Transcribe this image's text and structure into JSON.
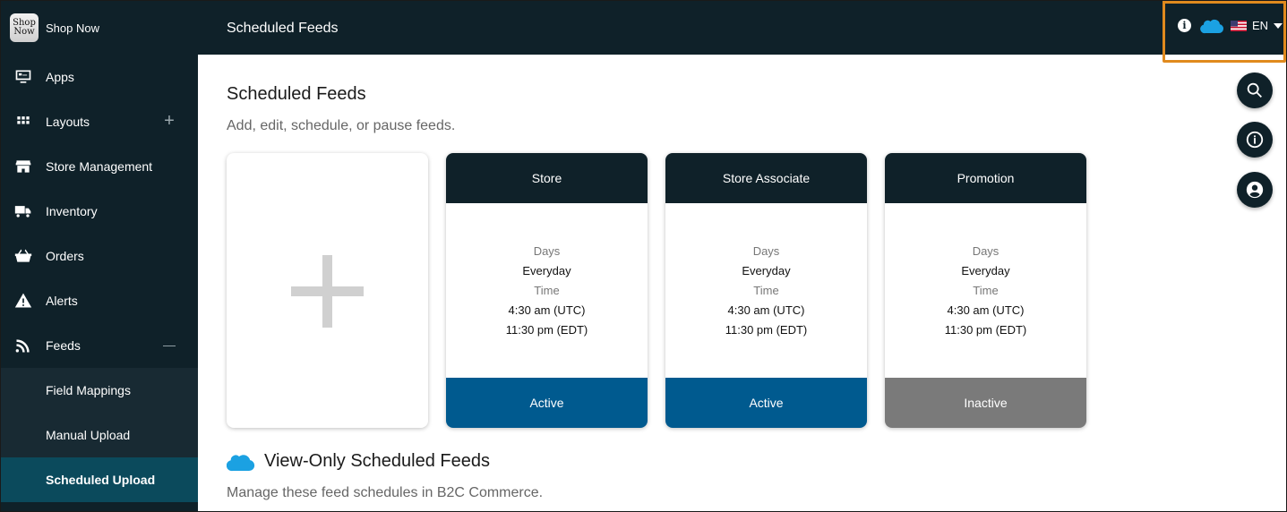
{
  "app": {
    "logo_line1": "Shop",
    "logo_line2": "Now",
    "name": "Shop Now"
  },
  "topbar": {
    "title": "Scheduled Feeds",
    "info_glyph": "i",
    "language": "EN"
  },
  "sidebar": {
    "items": [
      {
        "label": "Apps",
        "icon": "apps-monitor-icon"
      },
      {
        "label": "Layouts",
        "icon": "grid-icon",
        "toggle": "+"
      },
      {
        "label": "Store Management",
        "icon": "store-icon"
      },
      {
        "label": "Inventory",
        "icon": "truck-icon"
      },
      {
        "label": "Orders",
        "icon": "basket-icon"
      },
      {
        "label": "Alerts",
        "icon": "warning-icon"
      },
      {
        "label": "Feeds",
        "icon": "rss-icon",
        "toggle": "—"
      }
    ],
    "subitems": [
      {
        "label": "Field Mappings"
      },
      {
        "label": "Manual Upload"
      },
      {
        "label": "Scheduled Upload",
        "active": true
      }
    ]
  },
  "main": {
    "title": "Scheduled Feeds",
    "subtitle": "Add, edit, schedule, or pause feeds.",
    "feeds": [
      {
        "name": "Store",
        "days_label": "Days",
        "days": "Everyday",
        "time_label": "Time",
        "time_utc": "4:30 am (UTC)",
        "time_local": "11:30 pm (EDT)",
        "status": "Active"
      },
      {
        "name": "Store Associate",
        "days_label": "Days",
        "days": "Everyday",
        "time_label": "Time",
        "time_utc": "4:30 am (UTC)",
        "time_local": "11:30 pm (EDT)",
        "status": "Active"
      },
      {
        "name": "Promotion",
        "days_label": "Days",
        "days": "Everyday",
        "time_label": "Time",
        "time_utc": "4:30 am (UTC)",
        "time_local": "11:30 pm (EDT)",
        "status": "Inactive"
      }
    ],
    "view_only_title": "View-Only Scheduled Feeds",
    "view_only_subtitle": "Manage these feed schedules in B2C Commerce."
  },
  "colors": {
    "nav_bg": "#0f2129",
    "active_sub": "#0b4a5c",
    "status_active": "#005a8f",
    "status_inactive": "#7a7a7a",
    "highlight": "#e08a1e",
    "cloud": "#1ba1e2"
  }
}
